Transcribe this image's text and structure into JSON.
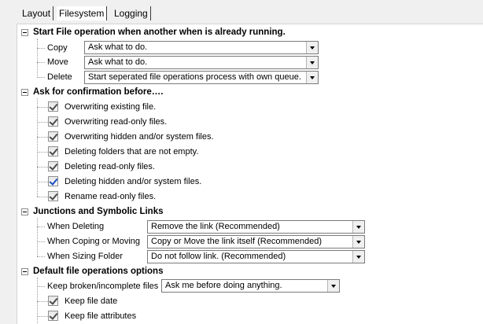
{
  "tabs": [
    "Layout",
    "Filesystem",
    "Logging"
  ],
  "sections": {
    "file_operation": {
      "title": "Start File operation when another when is already running.",
      "rows": [
        {
          "label": "Copy",
          "value": "Ask what to do."
        },
        {
          "label": "Move",
          "value": "Ask what to do."
        },
        {
          "label": "Delete",
          "value": "Start seperated file operations process with own queue."
        }
      ]
    },
    "confirmation": {
      "title": "Ask for confirmation before….",
      "items": [
        "Overwriting existing file.",
        "Overwriting read-only files.",
        "Overwriting hidden and/or system files.",
        "Deleting folders that are not empty.",
        "Deleting read-only files.",
        "Deleting hidden and/or system files.",
        "Rename read-only files."
      ]
    },
    "junctions": {
      "title": "Junctions and Symbolic Links",
      "rows": [
        {
          "label": "When Deleting",
          "value": "Remove the link (Recommended)"
        },
        {
          "label": "When Coping or Moving",
          "value": "Copy or Move the link itself (Recommended)"
        },
        {
          "label": "When Sizing Folder",
          "value": "Do not follow link. (Recommended)"
        }
      ]
    },
    "defaults": {
      "title": "Default file operations options",
      "broken_label": "Keep broken/incomplete files",
      "broken_value": "Ask me before doing anything.",
      "items": [
        "Keep file date",
        "Keep file attributes"
      ]
    }
  }
}
